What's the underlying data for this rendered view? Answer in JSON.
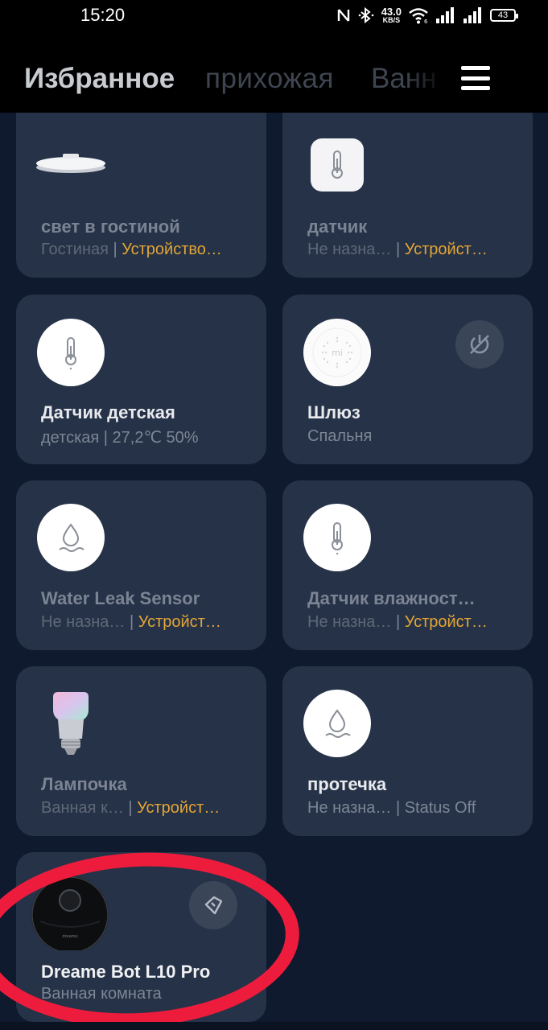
{
  "status_bar": {
    "time": "15:20",
    "net_speed_value": "43.0",
    "net_speed_unit": "KB/S",
    "battery": "43",
    "icons": [
      "nfc-icon",
      "bluetooth-icon",
      "wifi-icon",
      "signal-icon",
      "signal-icon"
    ]
  },
  "header": {
    "tabs": [
      {
        "label": "Избранное",
        "active": true
      },
      {
        "label": "прихожая",
        "active": false
      },
      {
        "label": "Ванная комната",
        "active": false
      }
    ],
    "menu_icon": "hamburger-icon"
  },
  "devices": [
    {
      "name": "свет в гостиной",
      "room": "Гостиная",
      "sep": " | ",
      "status": "Устройство…",
      "icon": "ceiling-light-icon",
      "online": false
    },
    {
      "name": "датчик",
      "room": "Не назна…",
      "sep": " | ",
      "status": "Устройст…",
      "icon": "thermometer-sensor-icon",
      "online": false
    },
    {
      "name": "Датчик детская",
      "room": "детская | 27,2℃ 50%",
      "icon": "thermometer-icon",
      "online": true
    },
    {
      "name": "Шлюз",
      "room": "Спальня",
      "icon": "gateway-icon",
      "online": true,
      "action_icon": "power-off-icon"
    },
    {
      "name": "Water Leak Sensor",
      "room": "Не назна…",
      "sep": " | ",
      "status": "Устройст…",
      "icon": "water-drop-icon",
      "online": false
    },
    {
      "name": "Датчик влажност…",
      "room": "Не назна…",
      "sep": " | ",
      "status": "Устройст…",
      "icon": "thermometer-icon",
      "online": false
    },
    {
      "name": "Лампочка",
      "room": "Ванная к…",
      "sep": " | ",
      "status": "Устройст…",
      "icon": "bulb-icon",
      "online": false
    },
    {
      "name": "протечка",
      "room": "Не назна… | Status Off",
      "icon": "water-drop-icon",
      "online": true
    },
    {
      "name": "Dreame Bot L10 Pro",
      "room": "Ванная комната",
      "icon": "robot-vacuum-icon",
      "online": true,
      "action_icon": "clean-icon"
    }
  ],
  "colors": {
    "background": "#101a2e",
    "card": "#263247",
    "accent_orange": "#e3a536",
    "annotation_red": "#ee1c3c"
  }
}
